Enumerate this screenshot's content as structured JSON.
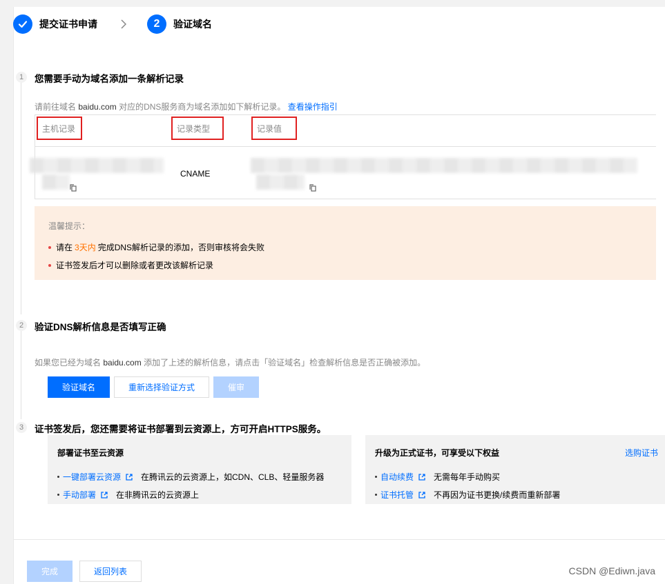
{
  "stepper": {
    "step1_label": "提交证书申请",
    "step2_number": "2",
    "step2_label": "验证域名"
  },
  "section1": {
    "number": "1",
    "title": "您需要手动为域名添加一条解析记录",
    "desc_prefix": "请前往域名",
    "domain": "baidu.com",
    "desc_dashed": "对应的DNS服务商",
    "desc_suffix": "为域名添加如下解析记录。",
    "guide_link": "查看操作指引",
    "table": {
      "headers": [
        "主机记录",
        "记录类型",
        "记录值"
      ],
      "record_type": "CNAME"
    },
    "tips": {
      "title": "温馨提示：",
      "line1_prefix": "请在",
      "line1_highlight": "3天内",
      "line1_suffix": "完成DNS解析记录的添加，否则审核将会失败",
      "line2": "证书签发后才可以删除或者更改该解析记录"
    }
  },
  "section2": {
    "number": "2",
    "title": "验证DNS解析信息是否填写正确",
    "desc_prefix": "如果您已经为域名",
    "domain": "baidu.com",
    "desc_suffix": "添加了上述的解析信息，请点击「验证域名」检查解析信息是否正确被添加。",
    "buttons": {
      "verify": "验证域名",
      "reselect": "重新选择验证方式",
      "urge": "催审"
    }
  },
  "section3": {
    "number": "3",
    "title": "证书签发后，您还需要将证书部署到云资源上，方可开启HTTPS服务。",
    "left_panel": {
      "title": "部署证书至云资源",
      "items": [
        {
          "link": "一键部署云资源",
          "text": "在腾讯云的云资源上，如CDN、CLB、轻量服务器"
        },
        {
          "link": "手动部署",
          "text": "在非腾讯云的云资源上"
        }
      ]
    },
    "right_panel": {
      "title": "升级为正式证书，可享受以下权益",
      "buy_link": "选购证书",
      "items": [
        {
          "link": "自动续费",
          "text": "无需每年手动购买"
        },
        {
          "link": "证书托管",
          "text": "不再因为证书更换/续费而重新部署"
        }
      ]
    }
  },
  "footer": {
    "done": "完成",
    "back": "返回列表"
  },
  "watermark": "CSDN @Ediwn.java",
  "colors": {
    "primary": "#006eff",
    "primary_disabled": "#b3d2ff",
    "tips_bg": "#fdeee2",
    "highlight": "#ff7200",
    "annotation_box": "#e02020"
  }
}
